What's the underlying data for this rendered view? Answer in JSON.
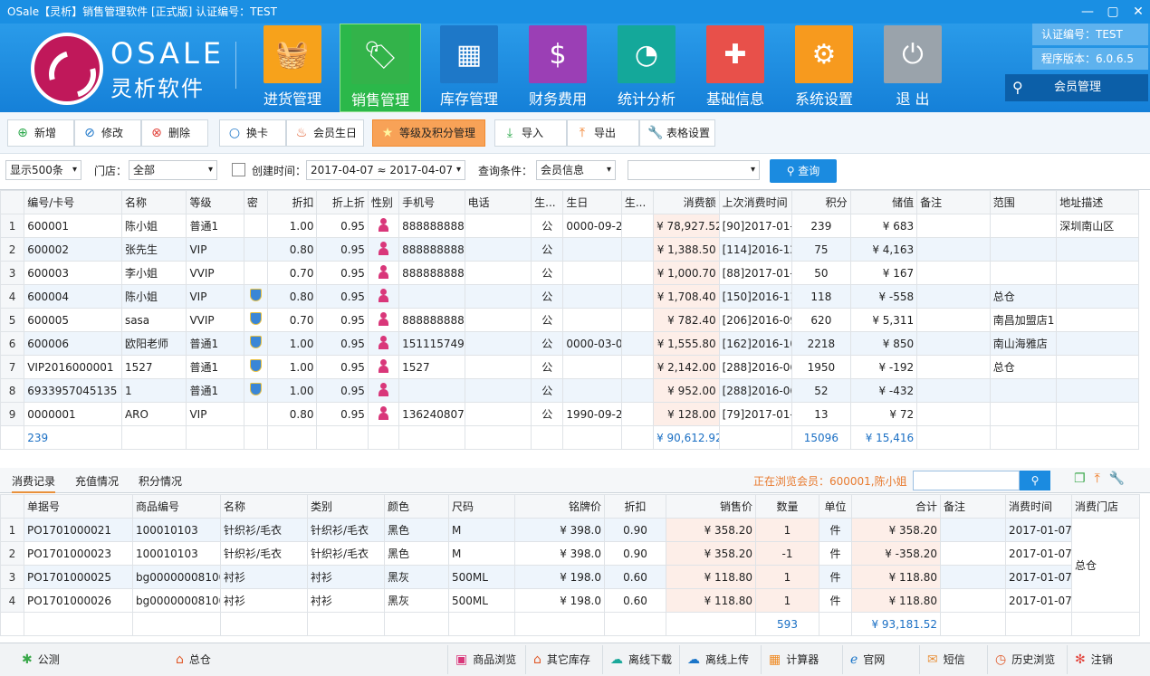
{
  "window": {
    "title": "OSale【灵析】销售管理软件    [正式版]  认证编号：TEST"
  },
  "brand": {
    "en": "OSALE",
    "cn": "灵析软件"
  },
  "nav": [
    {
      "label": "进货管理",
      "color": "#f7a21b",
      "icon": "basket-icon"
    },
    {
      "label": "销售管理",
      "color": "#33b34a",
      "icon": "price-tag-icon"
    },
    {
      "label": "库存管理",
      "color": "#1e78c8",
      "icon": "box-icon"
    },
    {
      "label": "财务费用",
      "color": "#9b3fb5",
      "icon": "money-bag-icon"
    },
    {
      "label": "统计分析",
      "color": "#14a89a",
      "icon": "pie-chart-icon"
    },
    {
      "label": "基础信息",
      "color": "#e8504a",
      "icon": "puzzle-icon"
    },
    {
      "label": "系统设置",
      "color": "#f79a1e",
      "icon": "gear-icon"
    },
    {
      "label": "退  出",
      "color": "#9aa3ab",
      "icon": "power-icon"
    }
  ],
  "info": {
    "cert": "认证编号：TEST",
    "version": "程序版本：6.0.6.5",
    "member": "会员管理"
  },
  "toolbar": {
    "add": "新增",
    "edit": "修改",
    "delete": "删除",
    "card": "换卡",
    "birthday": "会员生日",
    "level": "等级及积分管理",
    "import": "导入",
    "export": "导出",
    "tableset": "表格设置"
  },
  "filter": {
    "show": "显示500条",
    "store_label": "门店：",
    "store": "全部",
    "created_label": "创建时间：",
    "date_range": "2017-04-07 ≈ 2017-04-07",
    "cond_label": "查询条件：",
    "cond": "会员信息",
    "query": "查询"
  },
  "grid1": {
    "headers": [
      "编号/卡号",
      "名称",
      "等级",
      "密",
      "折扣",
      "折上折",
      "性别",
      "手机号",
      "电话",
      "生...",
      "生日",
      "生...",
      "消费额",
      "上次消费时间",
      "积分",
      "储值",
      "备注",
      "范围",
      "地址描述"
    ],
    "rows": [
      [
        "600001",
        "陈小姐",
        "普通1",
        "",
        "1.00",
        "0.95",
        "f",
        "8888888888",
        "",
        "公",
        "0000-09-2",
        "",
        "¥ 78,927.52",
        "[90]2017-01-0",
        "239",
        "¥ 683",
        "",
        "",
        "深圳南山区"
      ],
      [
        "600002",
        "张先生",
        "VIP",
        "",
        "0.80",
        "0.95",
        "f",
        "8888888888",
        "",
        "公",
        "",
        "",
        "¥ 1,388.50",
        "[114]2016-12",
        "75",
        "¥ 4,163",
        "",
        "",
        ""
      ],
      [
        "600003",
        "李小姐",
        "VVIP",
        "",
        "0.70",
        "0.95",
        "f",
        "8888888888",
        "",
        "公",
        "",
        "",
        "¥ 1,000.70",
        "[88]2017-01-0",
        "50",
        "¥ 167",
        "",
        "",
        ""
      ],
      [
        "600004",
        "陈小姐",
        "VIP",
        "s",
        "0.80",
        "0.95",
        "f",
        "",
        "",
        "公",
        "",
        "",
        "¥ 1,708.40",
        "[150]2016-11",
        "118",
        "¥ -558",
        "",
        "总仓",
        ""
      ],
      [
        "600005",
        "sasa",
        "VVIP",
        "s",
        "0.70",
        "0.95",
        "f",
        "8888888888",
        "",
        "公",
        "",
        "",
        "¥ 782.40",
        "[206]2016-09",
        "620",
        "¥ 5,311",
        "",
        "南昌加盟店1",
        ""
      ],
      [
        "600006",
        "欧阳老师",
        "普通1",
        "s",
        "1.00",
        "0.95",
        "f",
        "1511157496",
        "",
        "公",
        "0000-03-0",
        "",
        "¥ 1,555.80",
        "[162]2016-10",
        "2218",
        "¥ 850",
        "",
        "南山海雅店",
        ""
      ],
      [
        "VIP2016000001",
        "1527",
        "普通1",
        "s",
        "1.00",
        "0.95",
        "f",
        "1527",
        "",
        "公",
        "",
        "",
        "¥ 2,142.00",
        "[288]2016-06",
        "1950",
        "¥ -192",
        "",
        "总仓",
        ""
      ],
      [
        "6933957045135",
        "1",
        "普通1",
        "s",
        "1.00",
        "0.95",
        "f",
        "",
        "",
        "公",
        "",
        "",
        "¥ 952.00",
        "[288]2016-06",
        "52",
        "¥ -432",
        "",
        "",
        ""
      ],
      [
        "0000001",
        "ARO",
        "VIP",
        "",
        "0.80",
        "0.95",
        "f",
        "1362408077",
        "",
        "公",
        "1990-09-2",
        "",
        "¥ 128.00",
        "[79]2017-01-1",
        "13",
        "¥ 72",
        "",
        "",
        ""
      ]
    ],
    "sum": {
      "count": "239",
      "amount": "¥ 90,612.92",
      "points": "15096",
      "stored": "¥ 15,416"
    }
  },
  "tabs": {
    "t1": "消费记录",
    "t2": "充值情况",
    "t3": "积分情况",
    "browsing": "正在浏览会员：600001,陈小姐"
  },
  "grid2": {
    "headers": [
      "单据号",
      "商品编号",
      "名称",
      "类别",
      "颜色",
      "尺码",
      "铭牌价",
      "折扣",
      "销售价",
      "数量",
      "单位",
      "合计",
      "备注",
      "消费时间",
      "消费门店"
    ],
    "rows": [
      [
        "PO1701000021",
        "100010103",
        "针织衫/毛衣",
        "针织衫/毛衣",
        "黑色",
        "M",
        "¥ 398.0",
        "0.90",
        "¥ 358.20",
        "1",
        "件",
        "¥ 358.20",
        "",
        "2017-01-07"
      ],
      [
        "PO1701000023",
        "100010103",
        "针织衫/毛衣",
        "针织衫/毛衣",
        "黑色",
        "M",
        "¥ 398.0",
        "0.90",
        "¥ 358.20",
        "-1",
        "件",
        "¥ -358.20",
        "",
        "2017-01-07"
      ],
      [
        "PO1701000025",
        "bg00000008100",
        "衬衫",
        "衬衫",
        "黑灰",
        "500ML",
        "¥ 198.0",
        "0.60",
        "¥ 118.80",
        "1",
        "件",
        "¥ 118.80",
        "",
        "2017-01-07"
      ],
      [
        "PO1701000026",
        "bg00000008100",
        "衬衫",
        "衬衫",
        "黑灰",
        "500ML",
        "¥ 198.0",
        "0.60",
        "¥ 118.80",
        "1",
        "件",
        "¥ 118.80",
        "",
        "2017-01-07"
      ]
    ],
    "store": "总仓",
    "sum": {
      "qty": "593",
      "total": "¥ 93,181.52"
    }
  },
  "status": {
    "public": "公测",
    "store": "总仓",
    "items": [
      "商品浏览",
      "其它库存",
      "离线下载",
      "离线上传",
      "计算器",
      "官网",
      "短信",
      "历史浏览",
      "注销"
    ]
  }
}
